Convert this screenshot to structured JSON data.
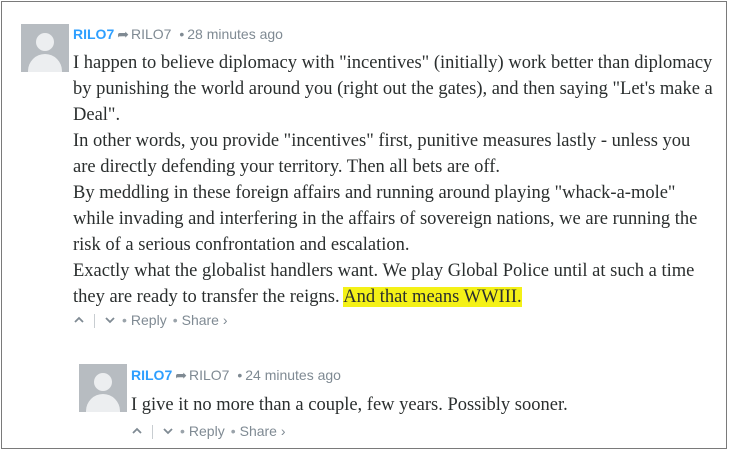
{
  "comments": [
    {
      "username": "RILO7",
      "reply_to": "RILO7",
      "separator": "•",
      "timestamp": "28 minutes ago",
      "paragraphs": [
        "I happen to believe diplomacy with \"incentives\" (initially) work better than diplomacy by punishing the world around you (right out the gates), and then saying \"Let's make a Deal\".",
        "In other words, you provide \"incentives\" first, punitive measures lastly - unless you are directly defending your territory. Then all bets are off.",
        "By meddling in these foreign affairs and running around playing \"whack-a-mole\" while invading and interfering in the affairs of sovereign nations, we are running the risk of a serious confrontation and escalation."
      ],
      "last_paragraph": "Exactly what the globalist handlers want. We play Global Police until at such a time they are ready to transfer the reigns.",
      "highlighted_text": "And that means WWIII.",
      "highlight_color": "#f4f117",
      "actions": {
        "upvote_icon": "chevron-up-icon",
        "downvote_icon": "chevron-down-icon",
        "reply": "Reply",
        "share": "Share ›"
      }
    },
    {
      "username": "RILO7",
      "reply_to": "RILO7",
      "separator": "•",
      "timestamp": "24 minutes ago",
      "text": "I give it no more than a couple, few years. Possibly sooner.",
      "actions": {
        "upvote_icon": "chevron-up-icon",
        "downvote_icon": "chevron-down-icon",
        "reply": "Reply",
        "share": "Share ›"
      }
    }
  ],
  "colors": {
    "username": "#2e9fff",
    "meta": "#7f8a93",
    "text": "#2a2e2e"
  }
}
